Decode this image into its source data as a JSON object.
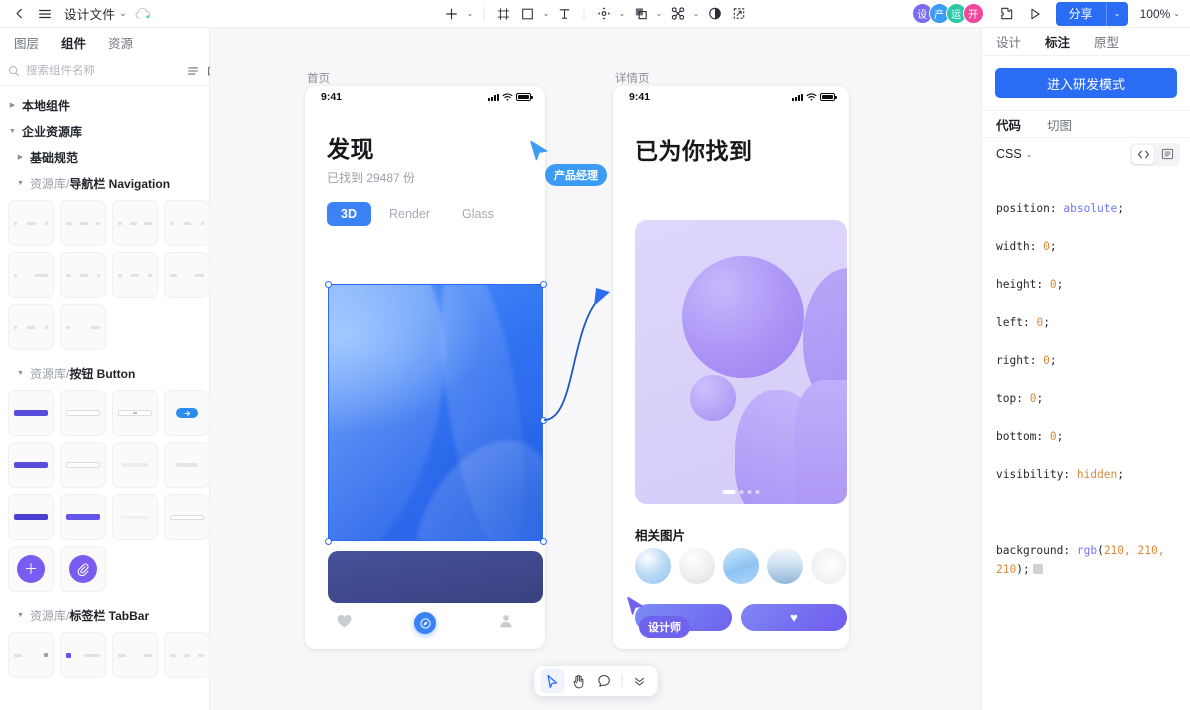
{
  "topbar": {
    "back_icon": "chevron-left-icon",
    "menu_icon": "hamburger-menu-icon",
    "doc_title": "设计文件",
    "title_caret": "⌄",
    "cloud_icon": "cloud-sync-icon",
    "tools": [
      {
        "name": "add-tool",
        "glyph": "＋",
        "caret": true
      },
      {
        "name": "frame-tool",
        "glyph": "frame",
        "caret": false
      },
      {
        "name": "shape-tool",
        "glyph": "rect",
        "caret": true
      },
      {
        "name": "text-tool",
        "glyph": "T",
        "caret": false
      },
      {
        "name": "vector-tool",
        "glyph": "pen",
        "caret": true
      },
      {
        "name": "boolean-tool",
        "glyph": "boolean",
        "caret": true
      },
      {
        "name": "component-tool",
        "glyph": "component",
        "caret": true
      },
      {
        "name": "mask-tool",
        "glyph": "mask",
        "caret": false
      },
      {
        "name": "slice-tool",
        "glyph": "slice",
        "caret": false
      }
    ],
    "avatars": [
      {
        "label": "设",
        "color": "#7a6cf0"
      },
      {
        "label": "产",
        "color": "#3b9bf5"
      },
      {
        "label": "运",
        "color": "#2ec7a9"
      },
      {
        "label": "开",
        "color": "#f0479a"
      }
    ],
    "plugin_icon": "plugin-icon",
    "play_icon": "play-preview-icon",
    "share_label": "分享",
    "share_caret": "⌄",
    "zoom_level": "100%",
    "zoom_caret": "⌄"
  },
  "left_panel": {
    "tabs": [
      {
        "label": "图层",
        "active": false
      },
      {
        "label": "组件",
        "active": true
      },
      {
        "label": "资源",
        "active": false
      }
    ],
    "search": {
      "icon": "search-icon",
      "placeholder": "搜索组件名称",
      "value": "",
      "list_icon": "list-view-icon",
      "library_icon": "library-icon"
    },
    "tree": [
      {
        "type": "node",
        "label": "本地组件",
        "open": false,
        "level": 1
      },
      {
        "type": "node",
        "label": "企业资源库",
        "open": true,
        "level": 1
      },
      {
        "type": "node",
        "label": "基础规范",
        "open": false,
        "level": 2
      },
      {
        "type": "group",
        "prefix": "资源库/",
        "name": "导航栏 Navigation",
        "open": true,
        "level": 2,
        "count": 10
      },
      {
        "type": "group",
        "prefix": "资源库/",
        "name": "按钮 Button",
        "open": true,
        "level": 2,
        "count": 14
      },
      {
        "type": "group",
        "prefix": "资源库/",
        "name": "标签栏 TabBar",
        "open": true,
        "level": 2,
        "count": 4
      }
    ]
  },
  "canvas": {
    "frames": [
      {
        "label": "首页"
      },
      {
        "label": "详情页"
      }
    ],
    "home_screen": {
      "status_time": "9:41",
      "title": "发现",
      "subtitle": "已找到 29487 份",
      "segments": [
        {
          "label": "3D",
          "active": true
        },
        {
          "label": "Render",
          "active": false
        },
        {
          "label": "Glass",
          "active": false
        }
      ],
      "tabbar": [
        {
          "name": "heart-icon",
          "active": false
        },
        {
          "name": "compass-icon",
          "active": true
        },
        {
          "name": "person-icon",
          "active": false
        }
      ]
    },
    "detail_screen": {
      "status_time": "9:41",
      "title": "已为你找到",
      "section_title": "相关图片",
      "thumb_count": 5,
      "pager_dots": 4,
      "pager_active": 0,
      "buttons": [
        {
          "name": "primary-action-button",
          "label": ""
        },
        {
          "name": "favorite-button",
          "label": "♥"
        }
      ]
    },
    "cursors": [
      {
        "label": "产品经理",
        "color": "#3b9bf5"
      },
      {
        "label": "设计师",
        "color": "#7a6cf0"
      }
    ],
    "bottom_toolbar": [
      {
        "name": "select-tool",
        "glyph": "cursor",
        "active": true
      },
      {
        "name": "hand-tool",
        "glyph": "hand",
        "active": false
      },
      {
        "name": "comment-tool",
        "glyph": "comment",
        "active": false
      },
      {
        "name": "more-tool",
        "glyph": "chevrons-down",
        "active": false
      }
    ]
  },
  "right_panel": {
    "tabs": [
      {
        "label": "设计",
        "active": false
      },
      {
        "label": "标注",
        "active": true
      },
      {
        "label": "原型",
        "active": false
      }
    ],
    "dev_button": "进入研发模式",
    "subtabs": [
      {
        "label": "代码",
        "active": true
      },
      {
        "label": "切图",
        "active": false
      }
    ],
    "code_lang": "CSS",
    "code_lang_caret": "⌄",
    "view_icons": [
      {
        "name": "code-view-icon",
        "glyph": "</>",
        "active": true
      },
      {
        "name": "list-view-icon",
        "glyph": "list",
        "active": false
      }
    ],
    "css_lines": [
      {
        "prop": "position",
        "value": "absolute",
        "kind": "kw"
      },
      {
        "prop": "width",
        "value": "0",
        "kind": "num"
      },
      {
        "prop": "height",
        "value": "0",
        "kind": "num"
      },
      {
        "prop": "left",
        "value": "0",
        "kind": "num"
      },
      {
        "prop": "right",
        "value": "0",
        "kind": "num"
      },
      {
        "prop": "top",
        "value": "0",
        "kind": "num"
      },
      {
        "prop": "bottom",
        "value": "0",
        "kind": "num"
      },
      {
        "prop": "visibility",
        "value": "hidden",
        "kind": "num"
      }
    ],
    "background_line": {
      "prop": "background",
      "fn": "rgb",
      "args": "210, 210, 210",
      "swatch_color": "#d2d2d2"
    }
  }
}
